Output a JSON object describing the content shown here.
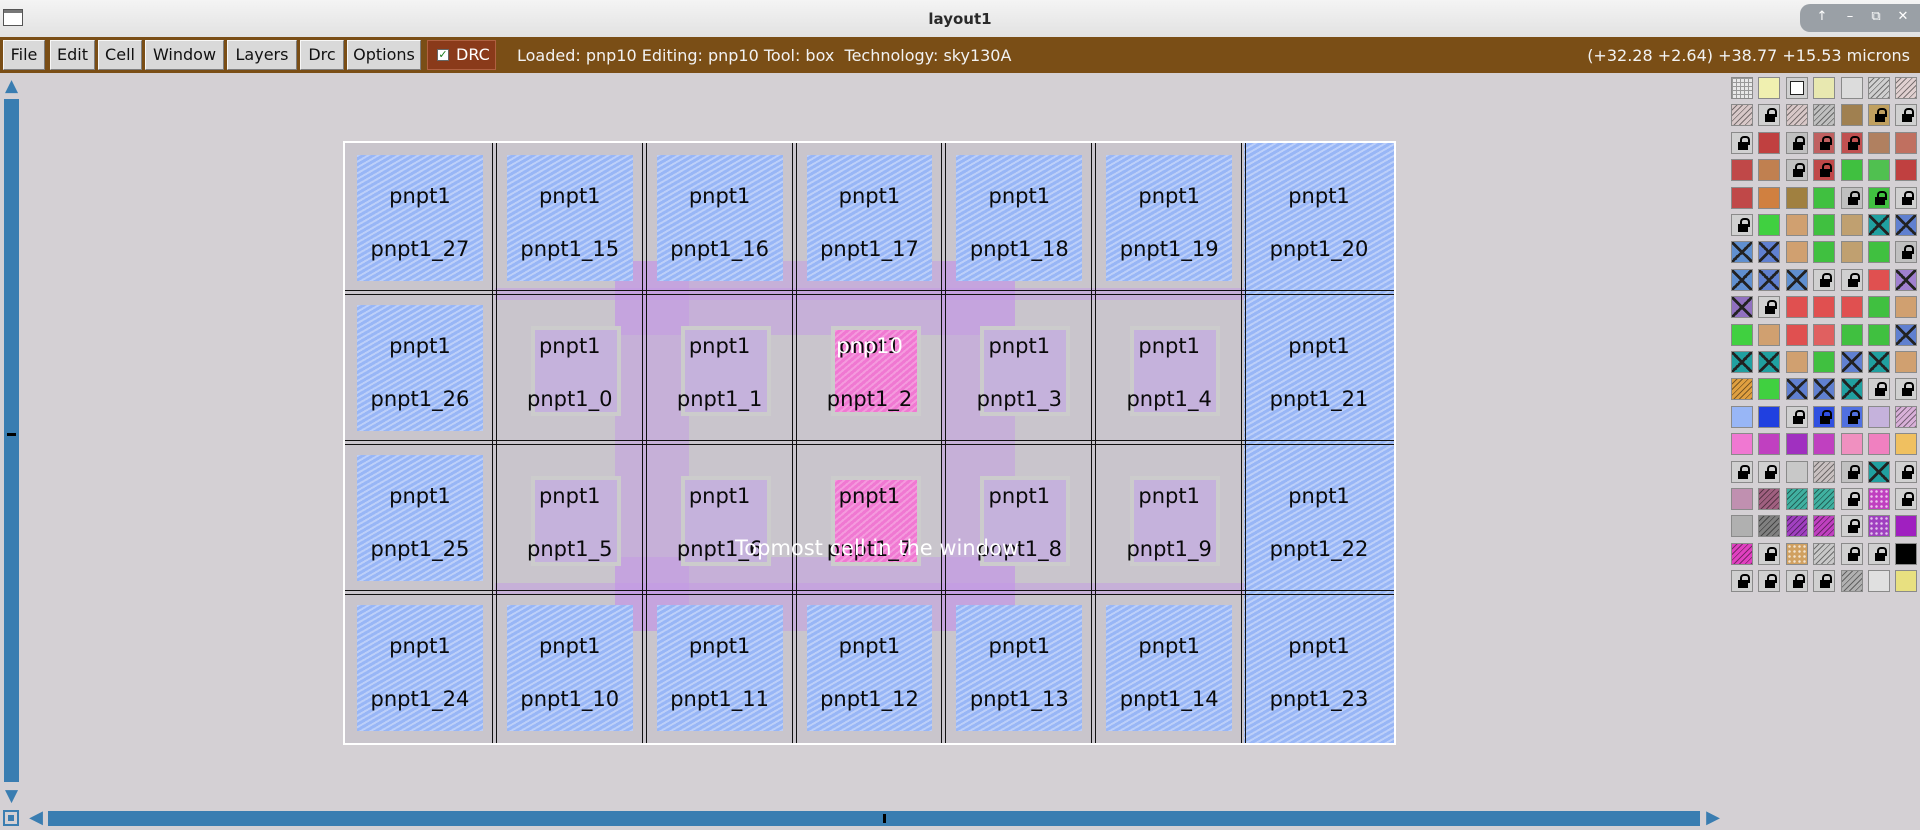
{
  "window": {
    "title": "layout1",
    "controls": [
      "↑",
      "–",
      "⧉",
      "✕"
    ]
  },
  "menu": {
    "items": [
      "File",
      "Edit",
      "Cell",
      "Window",
      "Layers",
      "Drc",
      "Options"
    ],
    "drc_label": "DRC",
    "drc_checked": true
  },
  "status": {
    "text": "Loaded: pnp10 Editing: pnp10 Tool: box  Technology: sky130A",
    "coords": "(+32.28 +2.64) +38.77 +15.53 microns"
  },
  "canvas": {
    "cell_type": "pnpt1",
    "rows": [
      [
        "pnpt1_27",
        "pnpt1_15",
        "pnpt1_16",
        "pnpt1_17",
        "pnpt1_18",
        "pnpt1_19",
        "pnpt1_20"
      ],
      [
        "pnpt1_26",
        "pnpt1_0",
        "pnpt1_1",
        "pnpt1_2",
        "pnpt1_3",
        "pnpt1_4",
        "pnpt1_21"
      ],
      [
        "pnpt1_25",
        "pnpt1_5",
        "pnpt1_6",
        "pnpt1_7",
        "pnpt1_8",
        "pnpt1_9",
        "pnpt1_22"
      ],
      [
        "pnpt1_24",
        "pnpt1_10",
        "pnpt1_11",
        "pnpt1_12",
        "pnpt1_13",
        "pnpt1_14",
        "pnpt1_23"
      ]
    ],
    "center_label": "pnp10",
    "topmost_text": "Topmost cell in the window"
  },
  "colors": {
    "menubar": "#7a4e16",
    "drc": "#8a3a1a",
    "hatch_blue": "#98b6f6",
    "pad_lavender": "#c5b2dc",
    "pad_pink": "#f078d2",
    "scrollbar": "#3a7db1"
  },
  "palette": {
    "icons": [
      "lock-icon"
    ],
    "swatches": [
      [
        "#e8e8e8:grid",
        "#f0f0b0",
        "#ffffff:box",
        "#e8e8b0",
        "#dcdcdc",
        "#d0d0d0:diag",
        "#e0d0d0:diag"
      ],
      [
        "#d8c8c8:diag",
        "#d0d0d0:lock",
        "#d8c8c8:diag",
        "#c0c0c0:diag",
        "#a08050",
        "#c0a060:lock",
        "#d0d0d0:lock"
      ],
      [
        "#d0d0d0:lock",
        "#c04040",
        "#c0c0c0:lock",
        "#c06060:lock",
        "#c05050:lock",
        "#b08060",
        "#c07060"
      ],
      [
        "#c04848",
        "#c08050",
        "#c0c0c0:lock",
        "#c04848:lock",
        "#40c040",
        "#50c050",
        "#c04040"
      ],
      [
        "#c04848",
        "#d08040",
        "#a08040",
        "#40c040",
        "#c0c0c0:lock",
        "#40c040:lock",
        "#d0d0d0:lock"
      ],
      [
        "#d0d0d0:lock",
        "#40d040",
        "#d0a070",
        "#40c040",
        "#c0a070",
        "#20a0a0:x",
        "#6080d0:x"
      ],
      [
        "#6090d0:x",
        "#6080d0:x",
        "#d0a070",
        "#40c040",
        "#c0a070",
        "#40c040",
        "#c0c0c0:lock"
      ],
      [
        "#6090d0:x",
        "#6080d0:x",
        "#6090d0:x",
        "#d0d0d0:lock",
        "#d0d0d0:lock",
        "#e05050",
        "#a080d0:x"
      ],
      [
        "#9070c0:x",
        "#d0d0d0:lock",
        "#e05050",
        "#e05050",
        "#e05050",
        "#40c040",
        "#d0a070"
      ],
      [
        "#40d040",
        "#d0a070",
        "#e05050",
        "#e06060",
        "#40c040",
        "#40c040",
        "#6080d0:x"
      ],
      [
        "#20a0a0:x",
        "#20a0a0:x",
        "#d0a070",
        "#40c040",
        "#6080d0:x",
        "#20a0a0:x",
        "#d0a070"
      ],
      [
        "#e0a040:diag",
        "#40d040",
        "#6080d0:x",
        "#6080d0:x",
        "#20a0a0:x",
        "#d0d0d0:lock",
        "#d0d0d0:lock"
      ],
      [
        "#98b6f6",
        "#2040e0",
        "#d0d0d0:lock",
        "#3050e0:lock",
        "#5070e0:lock",
        "#c5b2dc",
        "#d8b0d8:diag"
      ],
      [
        "#f078d2",
        "#c040c0",
        "#a030c0",
        "#c040c0",
        "#f090c0",
        "#f080c0",
        "#f0c060"
      ],
      [
        "#d0d0d0:lock",
        "#d0d0d0:lock",
        "#c8c8c8",
        "#c8c0c0:diag",
        "#c0c0c0:lock",
        "#20a0a0:x",
        "#d0d0d0:lock"
      ],
      [
        "#c090b0",
        "#a06080:diag",
        "#40b0a0:diag",
        "#40b0a0:diag",
        "#d0d0d0:lock",
        "#c040c0:dots",
        "#d0d0d0:lock"
      ],
      [
        "#b0b0b0",
        "#808080:diag",
        "#a040c0:diag",
        "#c040c0:diag",
        "#d0d0d0:lock",
        "#a040c0:dots",
        "#a020c0"
      ],
      [
        "#e040c0:diag",
        "#d0d0d0:lock",
        "#d0a060:dots",
        "#c8c8c8:diag",
        "#d0d0d0:lock",
        "#d0d0d0:lock",
        "#000000"
      ],
      [
        "#d0d0d0:lock",
        "#d0d0d0:lock",
        "#d0d0d0:lock",
        "#d0d0d0:lock",
        "#b0b0b0:diag",
        "#e0e0e0",
        "#e8e080"
      ]
    ]
  }
}
